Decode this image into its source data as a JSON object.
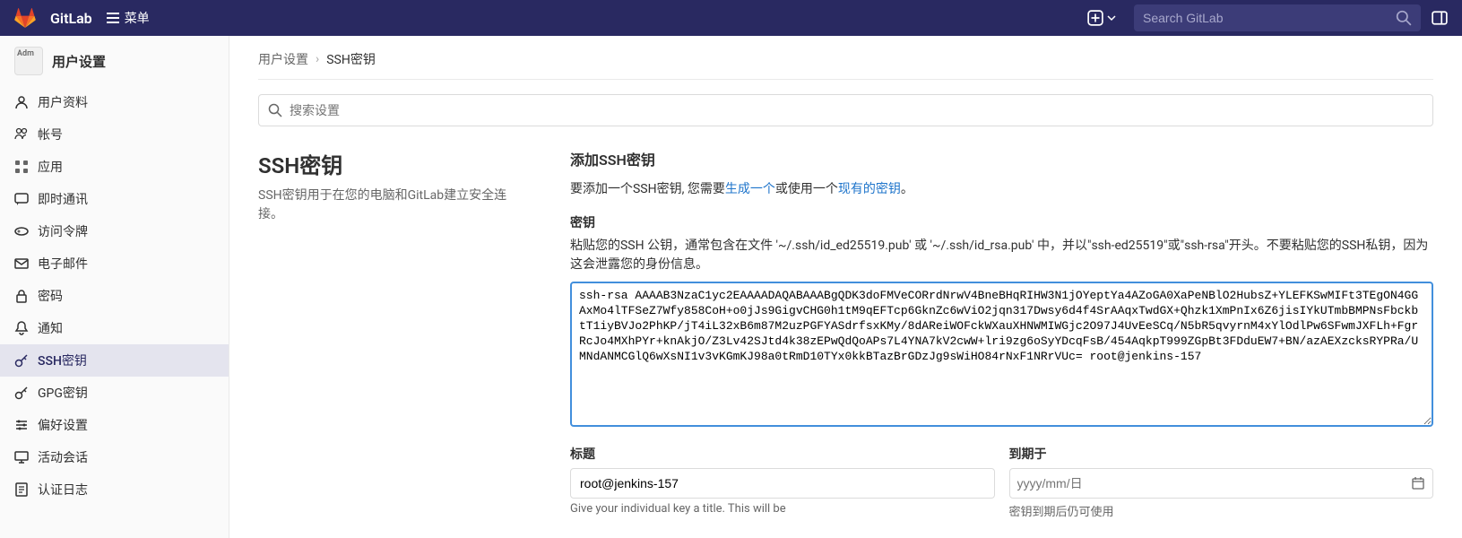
{
  "topbar": {
    "brand": "GitLab",
    "menu_label": "菜单",
    "search_placeholder": "Search GitLab"
  },
  "sidebar": {
    "header": "用户设置",
    "avatar_text": "Adm",
    "items": [
      {
        "label": "用户资料",
        "icon": "user"
      },
      {
        "label": "帐号",
        "icon": "account"
      },
      {
        "label": "应用",
        "icon": "apps"
      },
      {
        "label": "即时通讯",
        "icon": "chat"
      },
      {
        "label": "访问令牌",
        "icon": "token"
      },
      {
        "label": "电子邮件",
        "icon": "mail"
      },
      {
        "label": "密码",
        "icon": "lock"
      },
      {
        "label": "通知",
        "icon": "bell"
      },
      {
        "label": "SSH密钥",
        "icon": "key",
        "active": true
      },
      {
        "label": "GPG密钥",
        "icon": "key"
      },
      {
        "label": "偏好设置",
        "icon": "preferences"
      },
      {
        "label": "活动会话",
        "icon": "monitor"
      },
      {
        "label": "认证日志",
        "icon": "log"
      }
    ]
  },
  "breadcrumb": {
    "parent": "用户设置",
    "current": "SSH密钥"
  },
  "settings_search": {
    "placeholder": "搜索设置"
  },
  "section": {
    "title": "SSH密钥",
    "description": "SSH密钥用于在您的电脑和GitLab建立安全连接。"
  },
  "add_key": {
    "title": "添加SSH密钥",
    "help_prefix": "要添加一个SSH密钥, 您需要",
    "help_link1": "生成一个",
    "help_mid": "或使用一个",
    "help_link2": "现有的密钥",
    "help_suffix": "。",
    "key_label": "密钥",
    "key_desc": "粘贴您的SSH 公钥，通常包含在文件 '~/.ssh/id_ed25519.pub' 或 '~/.ssh/id_rsa.pub' 中，并以\"ssh-ed25519\"或\"ssh-rsa\"开头。不要粘贴您的SSH私钥，因为这会泄露您的身份信息。",
    "key_value": "ssh-rsa AAAAB3NzaC1yc2EAAAADAQABAAABgQDK3doFMVeCORrdNrwV4BneBHqRIHW3N1jOYeptYa4AZoGA0XaPeNBlO2HubsZ+YLEFKSwMIFt3TEgON4GGAxMo4lTFSeZ7Wfy858CoH+o0jJs9GigvCHG0h1tM9qEFTcp6GknZc6wViO2jqn317Dwsy6d4f4SrAAqxTwdGX+Qhzk1XmPnIx6Z6jisIYkUTmbBMPNsFbckbtT1iyBVJo2PhKP/jT4iL32xB6m87M2uzPGFYASdrfsxKMy/8dAReiWOFckWXauXHNWMIWGjc2O97J4UvEeSCq/N5bR5qvyrnM4xYlOdlPw6SFwmJXFLh+FgrRcJo4MXhPYr+knAkjO/Z3Lv42SJtd4k38zEPwQdQoAPs7L4YNA7kV2cwW+lri9zg6oSyYDcqFsB/454AqkpT999ZGpBt3FDduEW7+BN/azAEXzcksRYPRa/UMNdANMCGlQ6wXsNI1v3vKGmKJ98a0tRmD10TYx0kkBTazBrGDzJg9sWiHO84rNxF1NRrVUc= root@jenkins-157",
    "title_label": "标题",
    "title_value": "root@jenkins-157",
    "title_help": "Give your individual key a title. This will be",
    "expires_label": "到期于",
    "expires_placeholder": "yyyy/mm/日",
    "expires_help": "密钥到期后仍可使用"
  }
}
